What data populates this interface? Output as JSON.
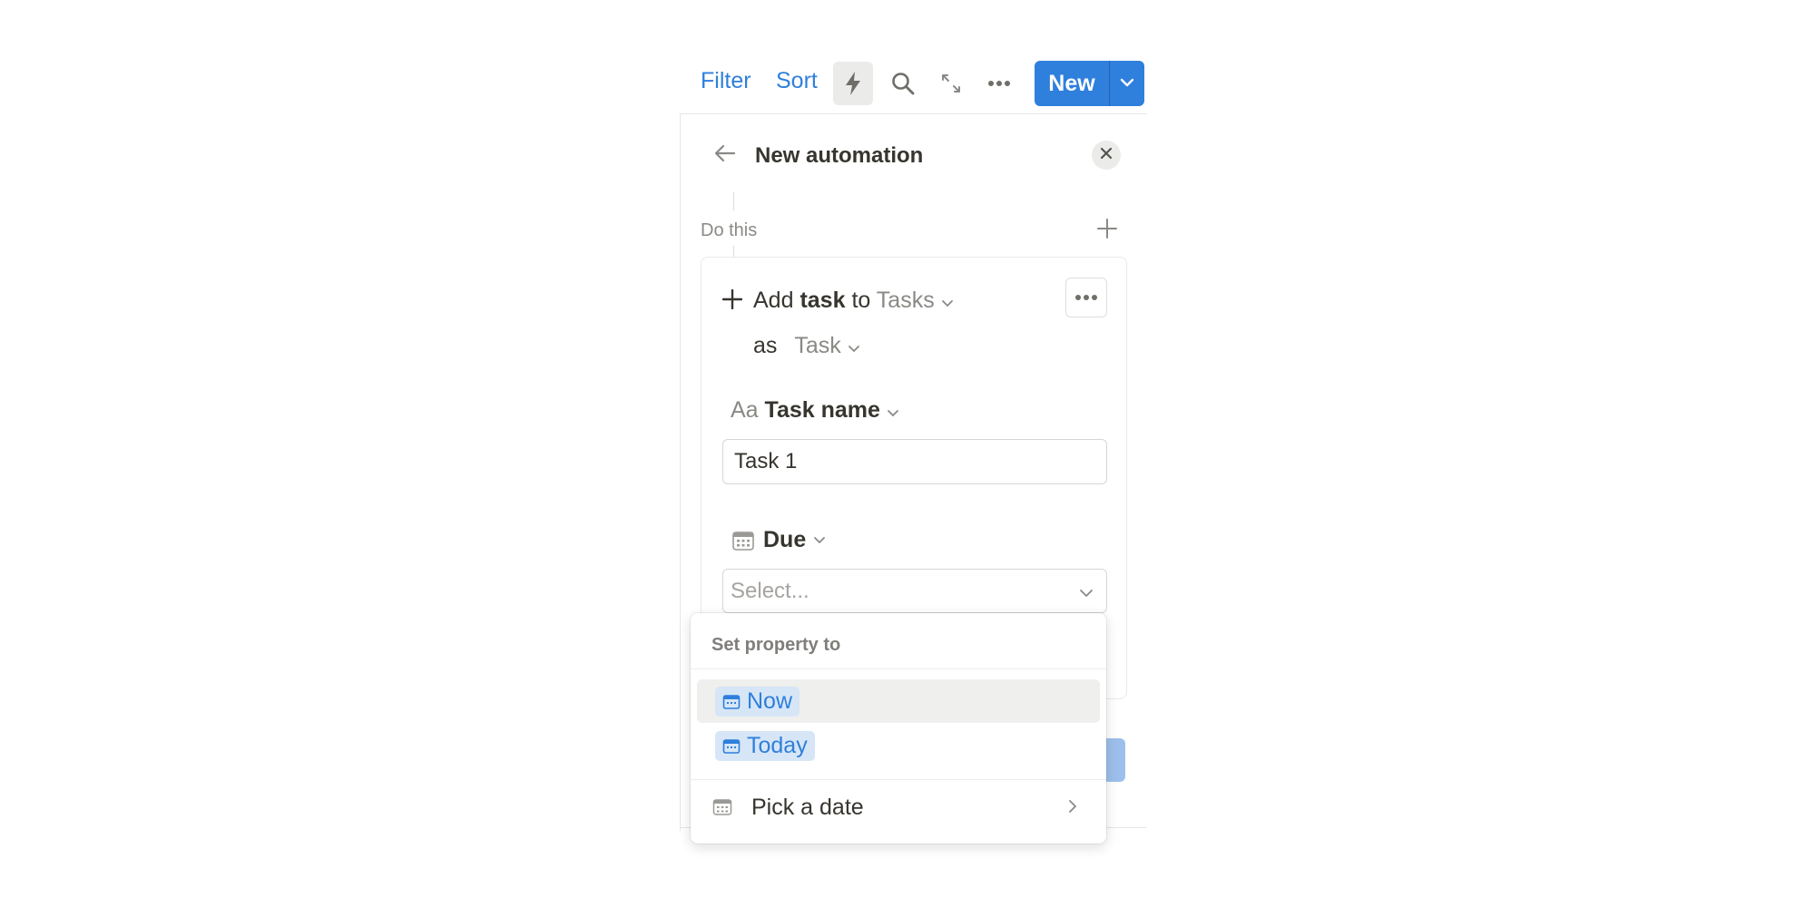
{
  "toolbar": {
    "filter_label": "Filter",
    "sort_label": "Sort",
    "new_label": "New",
    "icons": [
      "lightning-icon",
      "search-icon",
      "expand-icon",
      "more-icon",
      "chevron-down-icon"
    ]
  },
  "panel": {
    "title": "New automation",
    "section_label": "Do this"
  },
  "action": {
    "verb": "Add",
    "object": "task",
    "to_word": "to",
    "database": "Tasks",
    "as_word": "as",
    "template": "Task"
  },
  "fields": {
    "name_prefix": "Aa",
    "name_label": "Task name",
    "name_value": "Task 1",
    "due_label": "Due",
    "due_placeholder": "Select..."
  },
  "dropdown": {
    "header": "Set property to",
    "options": [
      {
        "label": "Now",
        "selected": true
      },
      {
        "label": "Today",
        "selected": false
      }
    ],
    "pick_label": "Pick a date"
  },
  "colors": {
    "accent": "#2f7fdc",
    "pill_bg": "#d6e6f7",
    "text": "#37352f",
    "muted": "#8a8985"
  }
}
